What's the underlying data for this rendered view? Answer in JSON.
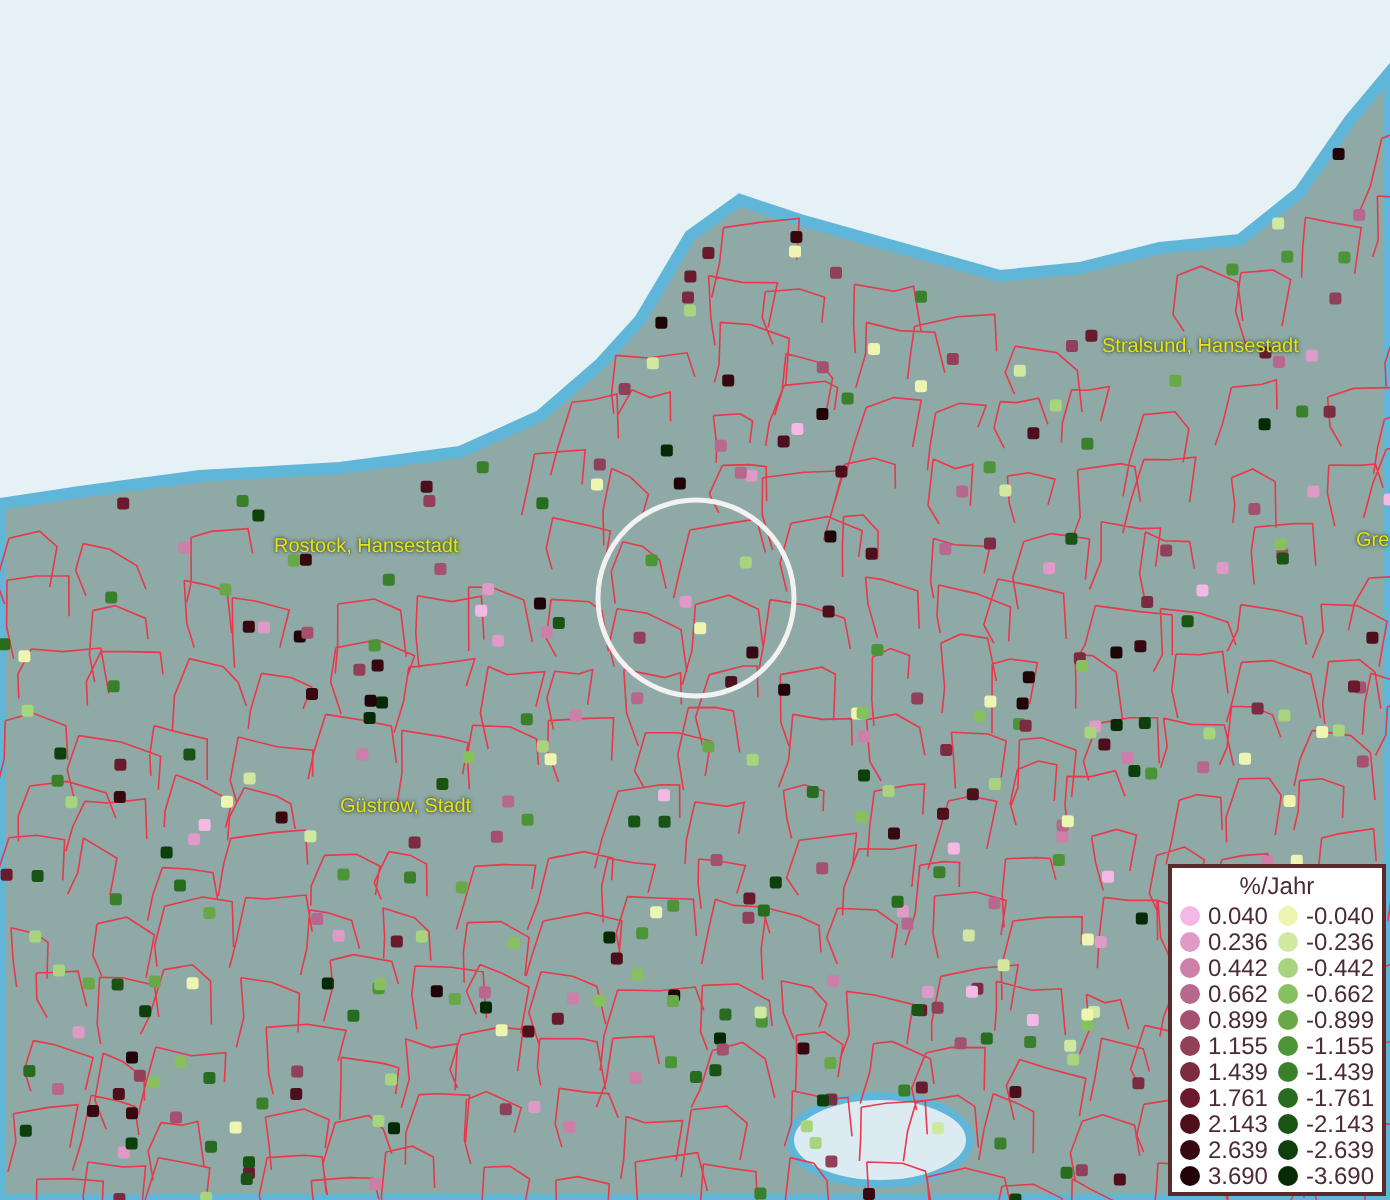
{
  "map": {
    "places": [
      {
        "name": "Rostock, Hansestadt"
      },
      {
        "name": "Stralsund, Hansestadt"
      },
      {
        "name": "Gre"
      },
      {
        "name": "Güstrow, Stadt"
      }
    ]
  },
  "legend": {
    "title": "%/Jahr",
    "positive": [
      {
        "label": "0.040",
        "color": "#f4b8e4"
      },
      {
        "label": "0.236",
        "color": "#e09ac8"
      },
      {
        "label": "0.442",
        "color": "#cc7fa8"
      },
      {
        "label": "0.662",
        "color": "#b8688e"
      },
      {
        "label": "0.899",
        "color": "#a4506f"
      },
      {
        "label": "1.155",
        "color": "#904058"
      },
      {
        "label": "1.439",
        "color": "#7c2c40"
      },
      {
        "label": "1.761",
        "color": "#6a1a2c"
      },
      {
        "label": "2.143",
        "color": "#4e0f1c"
      },
      {
        "label": "2.639",
        "color": "#380810"
      },
      {
        "label": "3.690",
        "color": "#200408"
      }
    ],
    "negative": [
      {
        "label": "-0.040",
        "color": "#eef5b0"
      },
      {
        "label": "-0.236",
        "color": "#d0e8a0"
      },
      {
        "label": "-0.442",
        "color": "#a8d47e"
      },
      {
        "label": "-0.662",
        "color": "#88c060"
      },
      {
        "label": "-0.899",
        "color": "#68a848"
      },
      {
        "label": "-1.155",
        "color": "#4c9438"
      },
      {
        "label": "-1.439",
        "color": "#3a802c"
      },
      {
        "label": "-1.761",
        "color": "#286c20"
      },
      {
        "label": "-2.143",
        "color": "#1a5414"
      },
      {
        "label": "-2.639",
        "color": "#0e400c"
      },
      {
        "label": "-3.690",
        "color": "#062a04"
      }
    ]
  }
}
